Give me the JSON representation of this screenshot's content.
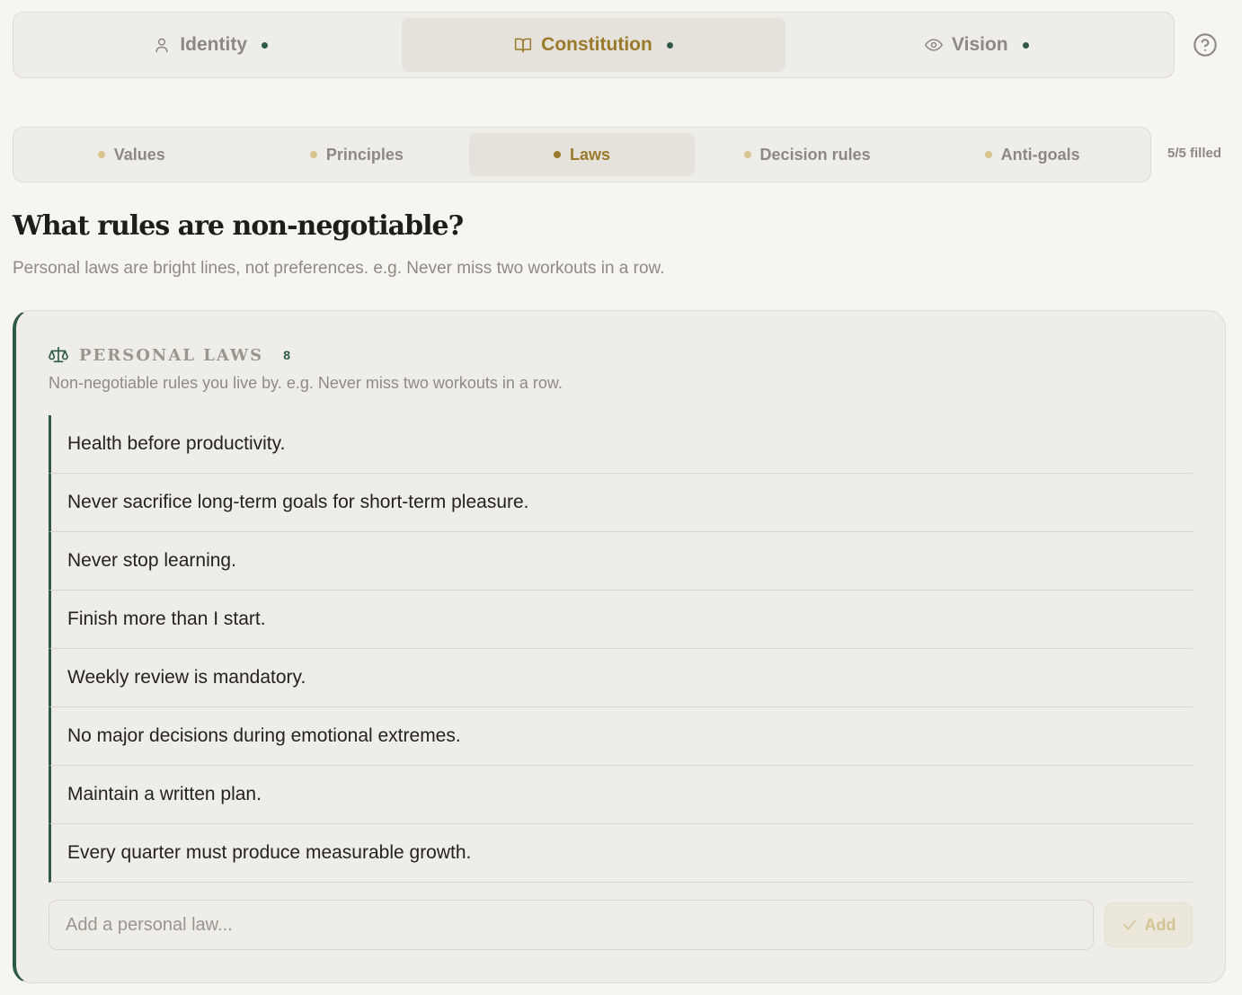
{
  "top_tabs": [
    {
      "label": "Identity",
      "icon": "user-icon",
      "active": false
    },
    {
      "label": "Constitution",
      "icon": "book-open-icon",
      "active": true
    },
    {
      "label": "Vision",
      "icon": "eye-icon",
      "active": false
    }
  ],
  "help": {
    "icon": "help-circle-icon"
  },
  "sub_tabs": [
    {
      "label": "Values",
      "active": false
    },
    {
      "label": "Principles",
      "active": false
    },
    {
      "label": "Laws",
      "active": true
    },
    {
      "label": "Decision rules",
      "active": false
    },
    {
      "label": "Anti-goals",
      "active": false
    }
  ],
  "filled_count": "5/5 filled",
  "question": {
    "title": "What rules are non-negotiable?",
    "subtitle": "Personal laws are bright lines, not preferences. e.g. Never miss two workouts in a row."
  },
  "card": {
    "icon": "scale-icon",
    "title": "PERSONAL LAWS",
    "count": "8",
    "description": "Non-negotiable rules you live by. e.g. Never miss two workouts in a row.",
    "laws": [
      "Health before productivity.",
      "Never sacrifice long-term goals for short-term pleasure.",
      "Never stop learning.",
      "Finish more than I start.",
      "Weekly review is mandatory.",
      "No major decisions during emotional extremes.",
      "Maintain a written plan.",
      "Every quarter must produce measurable growth."
    ],
    "input_placeholder": "Add a personal law...",
    "input_value": "",
    "add_label": "Add"
  },
  "colors": {
    "accent_gold": "#9a7a2a",
    "accent_green": "#2f5a45",
    "background": "#f7f5f1"
  }
}
